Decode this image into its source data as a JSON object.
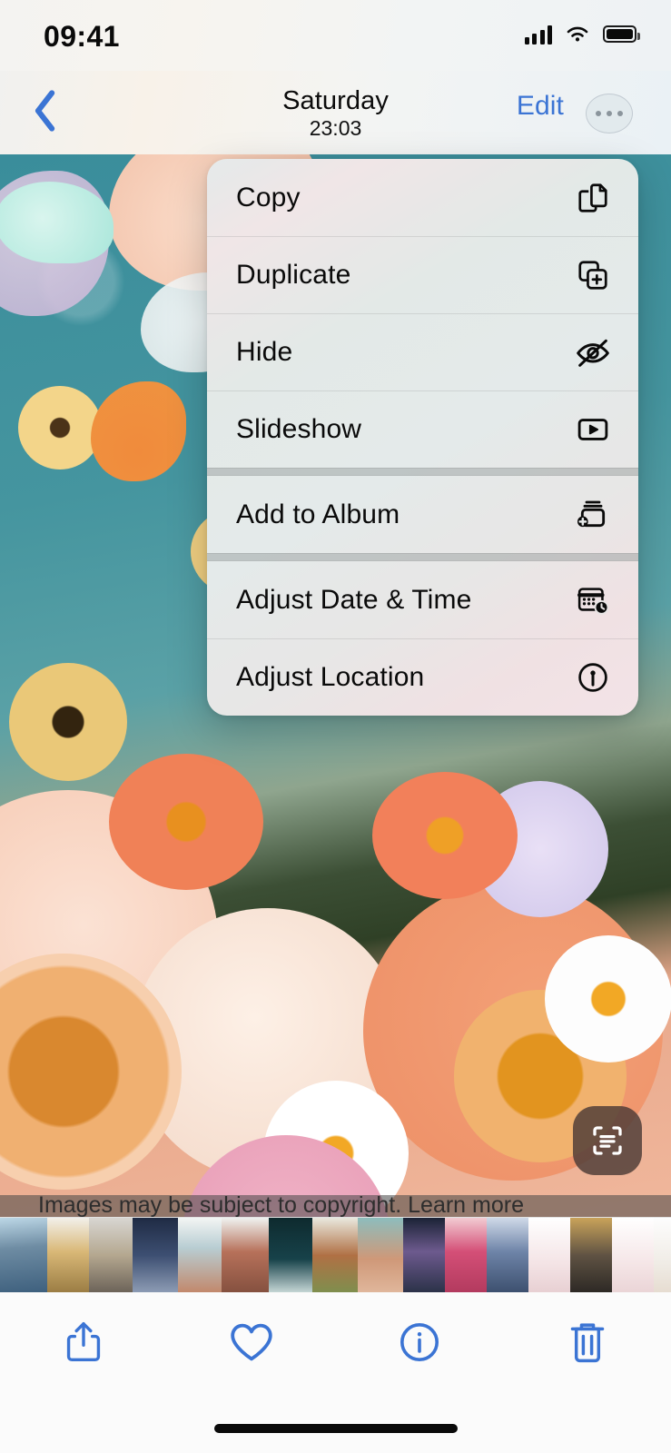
{
  "status_bar": {
    "time": "09:41",
    "signal_icon": "cellular-signal-icon",
    "wifi_icon": "wifi-icon",
    "battery_icon": "battery-icon"
  },
  "nav_bar": {
    "back_icon": "chevron-left-icon",
    "title_day": "Saturday",
    "title_time": "23:03",
    "edit_label": "Edit",
    "more_icon": "ellipsis-circle-icon",
    "accent_color": "#3b74d4"
  },
  "photo": {
    "description": "Wildflower collage photo with peach peonies, white daisies and a butterfly on teal sky",
    "copyright_notice": "Images may be subject to copyright. Learn more",
    "live_text_icon": "live-text-scan-icon"
  },
  "context_menu": {
    "groups": [
      {
        "items": [
          {
            "label": "Copy",
            "icon": "doc-on-doc-icon"
          },
          {
            "label": "Duplicate",
            "icon": "plus-square-on-square-icon"
          },
          {
            "label": "Hide",
            "icon": "eye-slash-icon"
          },
          {
            "label": "Slideshow",
            "icon": "play-rectangle-icon"
          }
        ]
      },
      {
        "items": [
          {
            "label": "Add to Album",
            "icon": "rectangle-stack-badge-plus-icon"
          }
        ]
      },
      {
        "items": [
          {
            "label": "Adjust Date & Time",
            "icon": "calendar-badge-clock-icon"
          },
          {
            "label": "Adjust Location",
            "icon": "location-circle-icon"
          }
        ]
      }
    ]
  },
  "filmstrip": {
    "thumbnails": [
      {
        "name": "city-skyline-blue"
      },
      {
        "name": "city-towers-gold"
      },
      {
        "name": "city-skyline-gray"
      },
      {
        "name": "city-street-night"
      },
      {
        "name": "city-buildings-teal"
      },
      {
        "name": "city-brick-building"
      },
      {
        "name": "city-tower-dark"
      },
      {
        "name": "historic-building"
      },
      {
        "name": "flower-field-teal"
      },
      {
        "name": "purple-flowers-dark"
      },
      {
        "name": "pink-blossoms"
      },
      {
        "name": "blue-blossoms"
      },
      {
        "name": "screenshot-list-pink"
      },
      {
        "name": "phone-photo-gold"
      },
      {
        "name": "screenshot-list-pink-2"
      },
      {
        "name": "screenshot-document"
      },
      {
        "name": "cosmetic-jar-product"
      }
    ]
  },
  "toolbar": {
    "items": [
      {
        "label": "Share",
        "icon": "share-icon"
      },
      {
        "label": "Favorite",
        "icon": "heart-icon"
      },
      {
        "label": "Info",
        "icon": "info-circle-icon"
      },
      {
        "label": "Delete",
        "icon": "trash-icon"
      }
    ],
    "accent_color": "#3b74d4"
  },
  "home_indicator": {
    "name": "home-indicator"
  }
}
